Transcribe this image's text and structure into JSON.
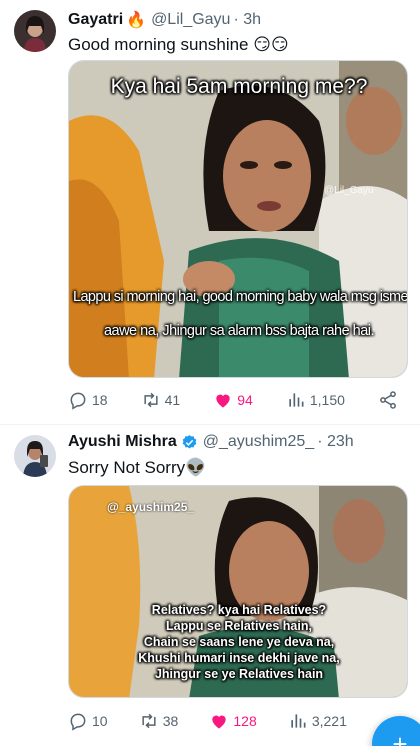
{
  "tweets": [
    {
      "name": "Gayatri",
      "name_emoji": "🔥",
      "handle": "@Lil_Gayu",
      "time": "· 3h",
      "text": "Good morning sunshine 😏😏",
      "meme": {
        "top_caption": "Kya hai 5am morning me??",
        "watermark": "@Lil_Gayu",
        "bottom_line1": "Lappu si morning hai, good morning baby wala msg isme",
        "bottom_line2": "aawe na, Jhingur sa alarm bss bajta rahe hai."
      },
      "replies": "18",
      "retweets": "41",
      "likes": "94",
      "views": "1,150"
    },
    {
      "name": "Ayushi Mishra",
      "verified": true,
      "handle": "@_ayushim25_",
      "time": "· 23h",
      "text": "Sorry Not Sorry👽",
      "meme": {
        "watermark": "@_ayushim25_",
        "lines": [
          "Relatives? kya hai Relatives?",
          "Lappu se Relatives hain,",
          "Chain se saans lene ye deva na,",
          "Khushi humari inse dekhi jave na,",
          "Jhingur se ye Relatives hain"
        ]
      },
      "replies": "10",
      "retweets": "38",
      "likes": "128",
      "views": "3,221"
    }
  ],
  "colors": {
    "text_secondary": "#536471",
    "like_pink": "#f91880",
    "verified_blue": "#1d9bf0",
    "fab_blue": "#1d9bf0"
  },
  "icons": [
    "reply-icon",
    "retweet-icon",
    "heart-icon",
    "views-icon",
    "share-icon",
    "verified-badge-icon",
    "compose-icon"
  ]
}
